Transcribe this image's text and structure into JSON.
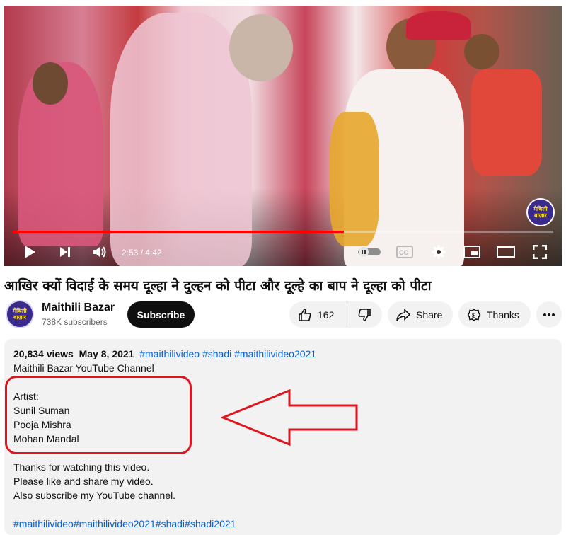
{
  "player": {
    "current_time": "2:53",
    "duration": "4:42",
    "time_separator": " / ",
    "progress_fraction": 0.613,
    "watermark_text": "मैथिली बाज़ार"
  },
  "video": {
    "title": "आखिर क्यों विदाई के समय दूल्हा ने दुल्हन को पीटा और दूल्हे का बाप ने दूल्हा को पीटा"
  },
  "channel": {
    "name": "Maithili Bazar",
    "subscribers": "738K subscribers",
    "avatar_text": "मैथिली बाज़ार",
    "subscribe_label": "Subscribe"
  },
  "actions": {
    "like_count": "162",
    "share_label": "Share",
    "thanks_label": "Thanks"
  },
  "description": {
    "views": "20,834 views",
    "date": "May 8, 2021",
    "tags": "#maithilivideo #shadi #maithilivideo2021",
    "lines": [
      "Maithili Bazar YouTube Channel",
      "",
      "Artist:",
      "Sunil Suman",
      "Pooja Mishra",
      "Mohan Mandal",
      "",
      "Thanks for watching this video.",
      "Please like and share my video.",
      "Also subscribe my YouTube channel.",
      "",
      "#maithilivideo#maithilivideo2021#shadi#shadi2021"
    ]
  },
  "colors": {
    "progress": "#ff0000",
    "annotation": "#e0141e",
    "link": "#065fd4"
  },
  "icons": [
    "play-icon",
    "next-icon",
    "volume-icon",
    "autoplay-toggle-icon",
    "captions-icon",
    "settings-icon",
    "miniplayer-icon",
    "theater-icon",
    "fullscreen-icon",
    "thumbs-up-icon",
    "thumbs-down-icon",
    "share-icon",
    "thanks-icon",
    "more-icon"
  ]
}
